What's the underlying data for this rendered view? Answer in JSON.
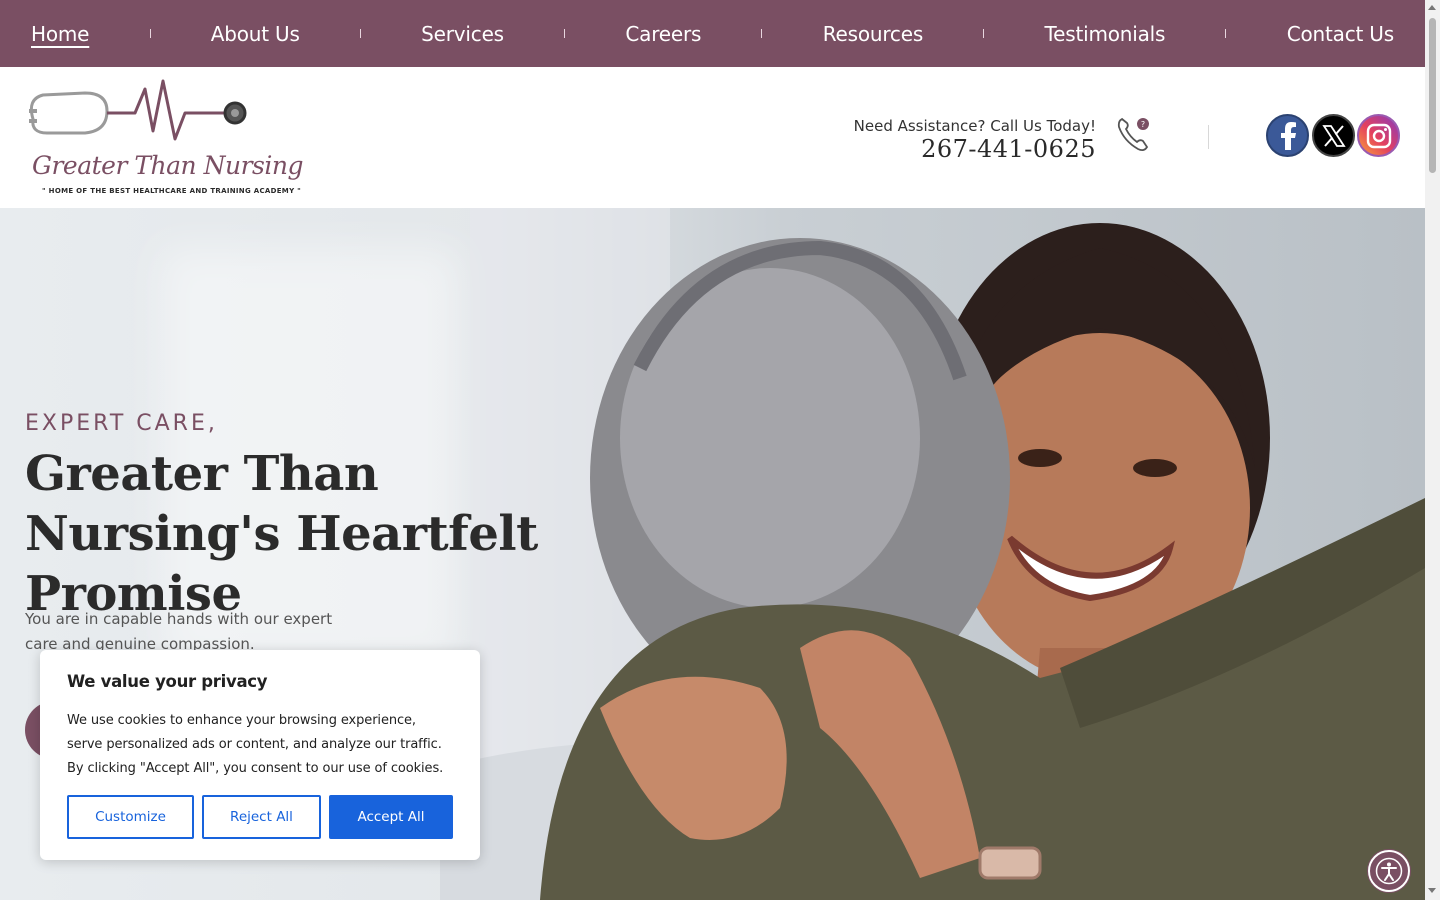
{
  "nav": {
    "items": [
      {
        "label": "Home",
        "active": true
      },
      {
        "label": "About Us"
      },
      {
        "label": "Services"
      },
      {
        "label": "Careers"
      },
      {
        "label": "Resources"
      },
      {
        "label": "Testimonials"
      },
      {
        "label": "Contact Us"
      }
    ]
  },
  "header": {
    "logo_text": "Greater Than Nursing",
    "logo_tagline": "\" HOME OF THE BEST HEALTHCARE AND TRAINING ACADEMY \"",
    "assist_label": "Need Assistance? Call Us Today!",
    "phone": "267-441-0625",
    "social": [
      "facebook-icon",
      "x-icon",
      "instagram-icon"
    ]
  },
  "hero": {
    "eyebrow": "EXPERT CARE,",
    "title": "Greater Than Nursing's Heartfelt Promise",
    "subtitle": "You are in capable hands with our expert care and genuine compassion."
  },
  "cookie": {
    "title": "We value your privacy",
    "text": "We use cookies to enhance your browsing experience, serve personalized ads or content, and analyze our traffic. By clicking \"Accept All\", you consent to our use of cookies.",
    "customize_label": "Customize",
    "reject_label": "Reject All",
    "accept_label": "Accept All"
  },
  "colors": {
    "brand": "#7a4f63",
    "cookie_accent": "#1863dc"
  }
}
